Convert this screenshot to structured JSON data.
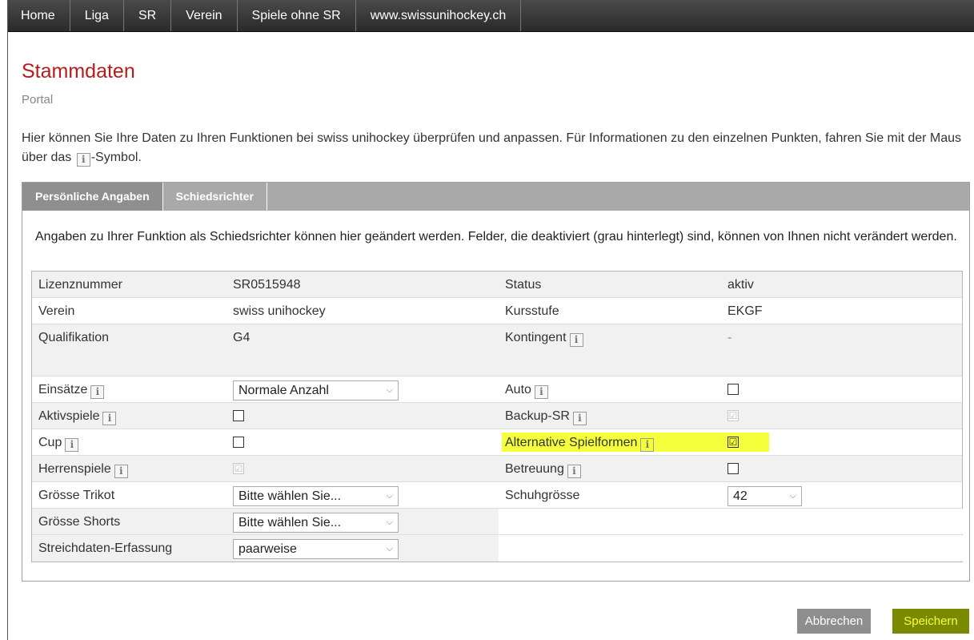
{
  "nav": {
    "items": [
      "Home",
      "Liga",
      "SR",
      "Verein",
      "Spiele ohne SR",
      "www.swissunihockey.ch"
    ]
  },
  "page": {
    "title": "Stammdaten",
    "subtitle": "Portal",
    "intro_part1": "Hier können Sie Ihre Daten zu Ihren Funktionen bei swiss unihockey überprüfen und anpassen. Für Informationen zu den einzelnen Punkten, fahren Sie mit der Maus über das ",
    "intro_part2": "-Symbol."
  },
  "info_icon_glyph": "i",
  "tabs": [
    "Persönliche Angaben",
    "Schiedsrichter"
  ],
  "panel": {
    "description": "Angaben zu Ihrer Funktion als Schiedsrichter können hier geändert werden. Felder, die deaktiviert (grau hinterlegt) sind, können von Ihnen nicht verändert werden."
  },
  "fields": {
    "lizenz_label": "Lizenznummer",
    "lizenz_value": "SR0515948",
    "status_label": "Status",
    "status_value": "aktiv",
    "verein_label": "Verein",
    "verein_value": "swiss unihockey",
    "kursstufe_label": "Kursstufe",
    "kursstufe_value": "EKGF",
    "qualifikation_label": "Qualifikation",
    "qualifikation_value": "G4",
    "kontingent_label": "Kontingent",
    "kontingent_value": "-",
    "einsaetze_label": "Einsätze",
    "einsaetze_value": "Normale Anzahl",
    "auto_label": "Auto",
    "aktivspiele_label": "Aktivspiele",
    "backup_label": "Backup-SR",
    "cup_label": "Cup",
    "alternative_label": "Alternative Spielformen",
    "herrenspiele_label": "Herrenspiele",
    "betreuung_label": "Betreuung",
    "trikot_label": "Grösse Trikot",
    "trikot_value": "Bitte wählen Sie...",
    "schuh_label": "Schuhgrösse",
    "schuh_value": "42",
    "shorts_label": "Grösse Shorts",
    "shorts_value": "Bitte wählen Sie...",
    "streich_label": "Streichdaten-Erfassung",
    "streich_value": "paarweise"
  },
  "checkboxes": {
    "auto": false,
    "aktivspiele": false,
    "backup_sr": true,
    "cup": false,
    "alternative_spielformen": true,
    "herrenspiele": true,
    "betreuung": false
  },
  "icons": {
    "checkmark": "☑",
    "chevron": "⌵"
  },
  "buttons": {
    "cancel": "Abbrechen",
    "save": "Speichern"
  },
  "colors": {
    "title": "#b71c1c",
    "highlight": "#f6ff3c",
    "save_button": "#7a8a00",
    "cancel_button": "#8e8e8e"
  }
}
